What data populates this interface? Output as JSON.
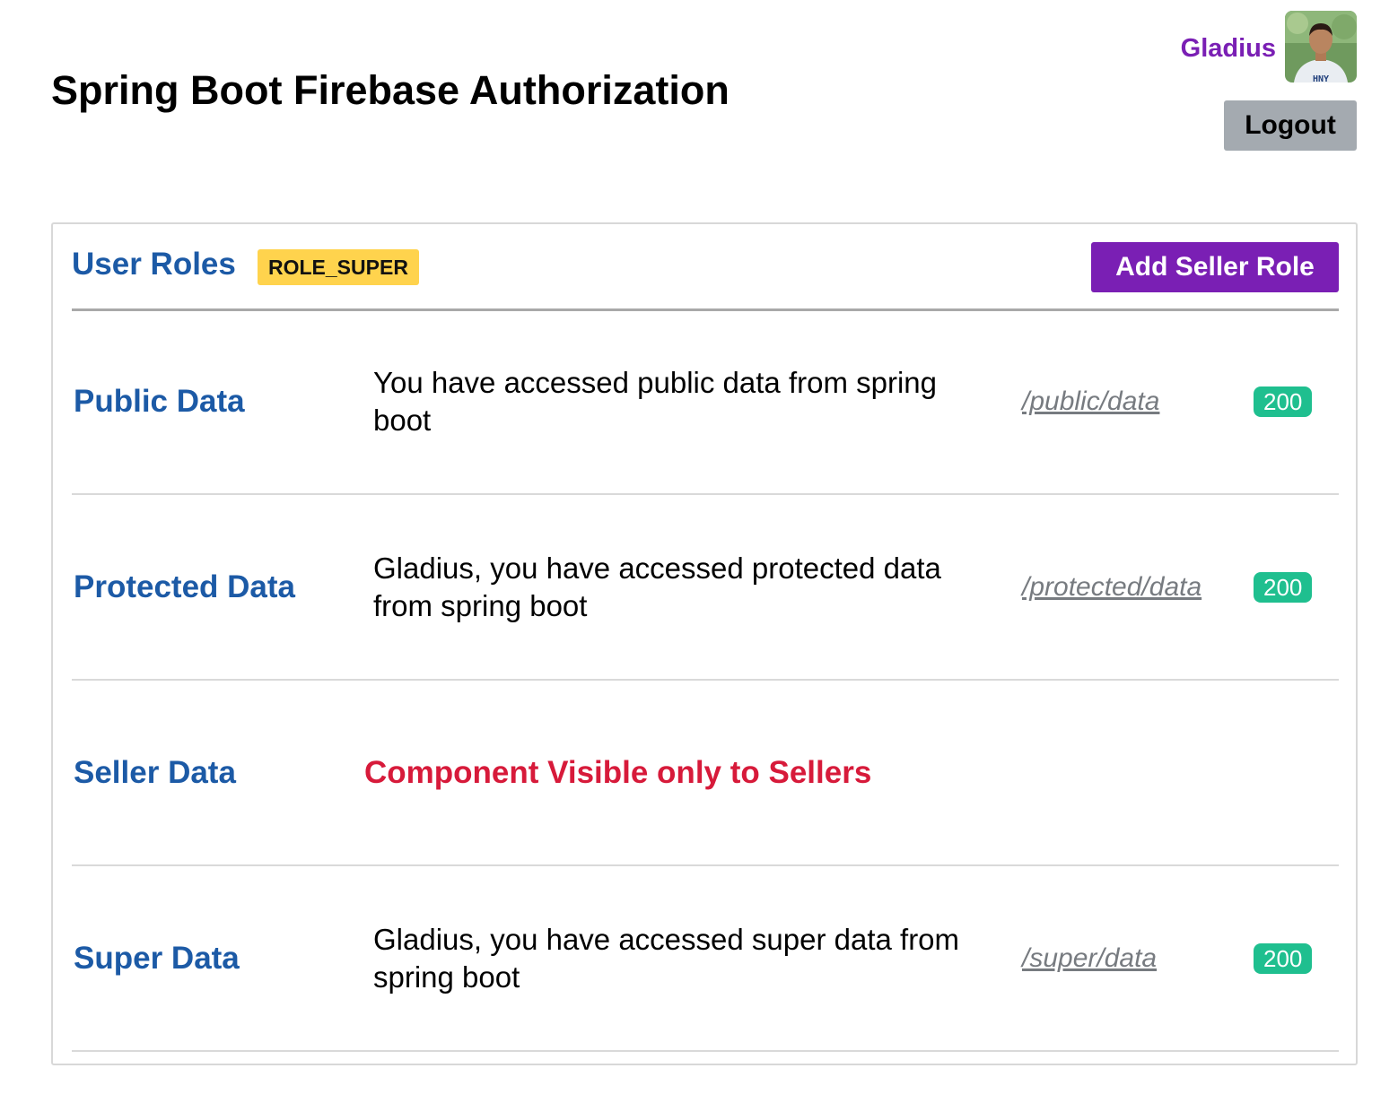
{
  "header": {
    "title": "Spring Boot Firebase Authorization",
    "user_name": "Gladius",
    "avatar_shirt_text": "HNY",
    "logout_label": "Logout"
  },
  "roles": {
    "label": "User Roles",
    "badge": "ROLE_SUPER",
    "add_button": "Add Seller Role"
  },
  "rows": [
    {
      "label": "Public Data",
      "message": "You have accessed public data from spring boot",
      "endpoint": "/public/data",
      "status": "200"
    },
    {
      "label": "Protected Data",
      "message": "Gladius, you have accessed protected data from spring boot",
      "endpoint": "/protected/data",
      "status": "200"
    },
    {
      "label": "Seller Data",
      "restricted": "Component Visible only to Sellers"
    },
    {
      "label": "Super Data",
      "message": "Gladius, you have accessed super data from spring boot",
      "endpoint": "/super/data",
      "status": "200"
    }
  ],
  "colors": {
    "accent_purple": "#7a1fb4",
    "label_blue": "#1c5aa6",
    "badge_yellow": "#ffd34d",
    "status_green": "#1fbf8f",
    "restricted_red": "#d71a3a",
    "logout_gray": "#a4aab0"
  }
}
